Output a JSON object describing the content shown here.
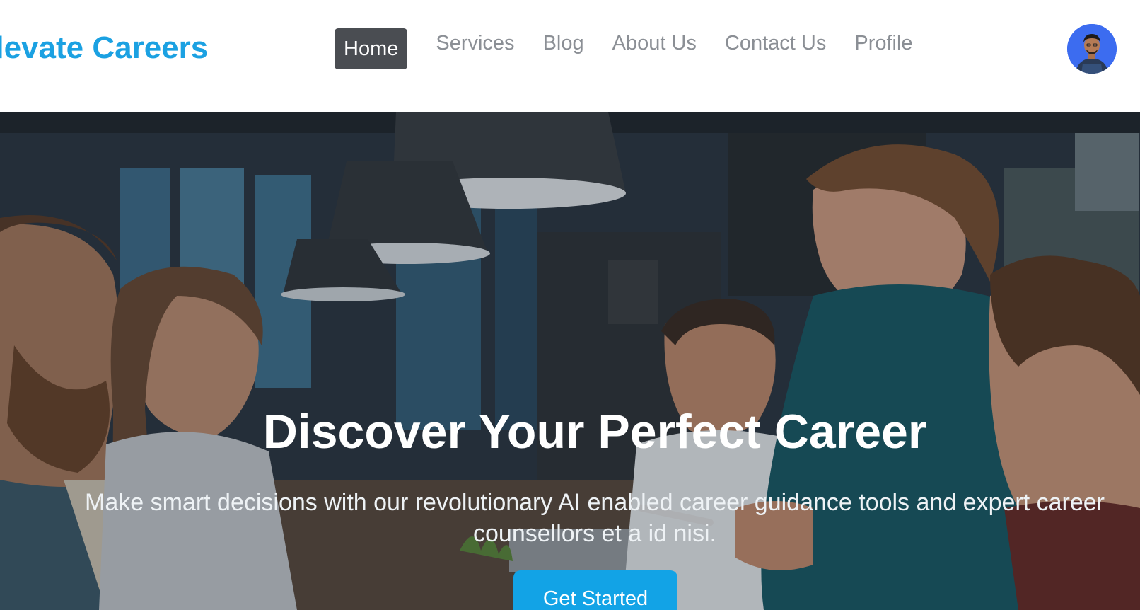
{
  "header": {
    "brand": "Elevate Careers",
    "nav": [
      {
        "label": "Home",
        "active": true
      },
      {
        "label": "Services",
        "active": false
      },
      {
        "label": "Blog",
        "active": false
      },
      {
        "label": "About Us",
        "active": false
      },
      {
        "label": "Contact Us",
        "active": false
      },
      {
        "label": "Profile",
        "active": false
      }
    ],
    "avatar_icon": "user-avatar-icon"
  },
  "hero": {
    "title": "Discover Your Perfect Career",
    "subtitle": "Make smart decisions with our revolutionary AI enabled career guidance tools and expert career counsellors et a id nisi.",
    "cta_label": "Get Started",
    "background_icon": "team-meeting-photo"
  },
  "colors": {
    "brand": "#1ba1e2",
    "nav_text": "#8b8f95",
    "nav_active_bg": "#4a4d52",
    "cta_bg": "#12a3e6",
    "avatar_bg": "#3c6cf0"
  }
}
